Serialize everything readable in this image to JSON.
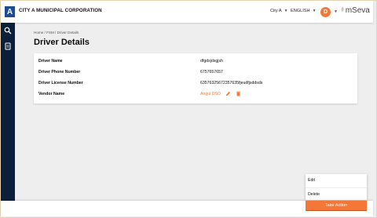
{
  "header": {
    "logo_letter": "A",
    "corporation": "CITY A MUNICIPAL CORPORATION",
    "city_select": "City A",
    "language_select": "ENGLISH",
    "avatar_letter": "D",
    "brand": "mSeva"
  },
  "sidebar": {
    "items": [
      {
        "icon": "search-icon"
      },
      {
        "icon": "document-icon"
      }
    ]
  },
  "breadcrumb": "Home / FSM / Driver Details",
  "page_title": "Driver Details",
  "details": {
    "rows": [
      {
        "label": "Driver Name",
        "value": "dfgdsjdsgjsh"
      },
      {
        "label": "Driver Phone Number",
        "value": "6757657657"
      },
      {
        "label": "Driver License Number",
        "value": "6357632567235763​5fjeudfjsddsds"
      },
      {
        "label": "Vendor Name",
        "value": "Angul DSO"
      }
    ]
  },
  "action_menu": {
    "items": [
      "Edit",
      "Delete"
    ]
  },
  "take_action_label": "Take Action",
  "colors": {
    "accent": "#f47738",
    "sidebar": "#0b1f3a",
    "logo": "#1f4b8f"
  }
}
